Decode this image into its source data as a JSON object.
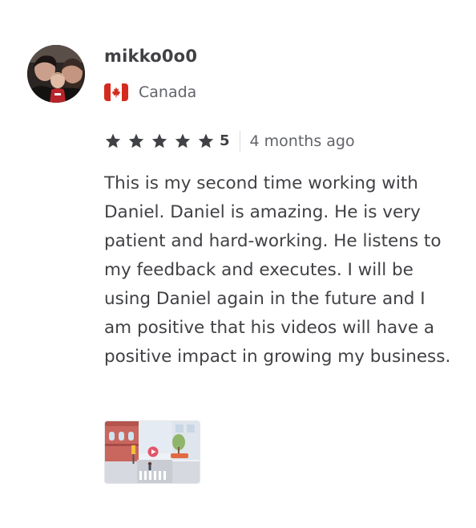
{
  "review": {
    "username": "mikko0o0",
    "country": "Canada",
    "flag_icon": "canada-flag-icon",
    "star_icon": "star-icon",
    "rating": "5",
    "stars_filled": 5,
    "time_ago": "4 months ago",
    "text": "This is my second time working with Daniel. Daniel is amazing. He is very patient and hard-working. He listens to my feedback and executes. I will be using Daniel again in the future and I am positive that his videos will have a positive impact in growing my business.",
    "colors": {
      "name": "#404145",
      "secondary": "#62646a",
      "star": "#404145",
      "flag_red": "#d52b1e"
    }
  }
}
